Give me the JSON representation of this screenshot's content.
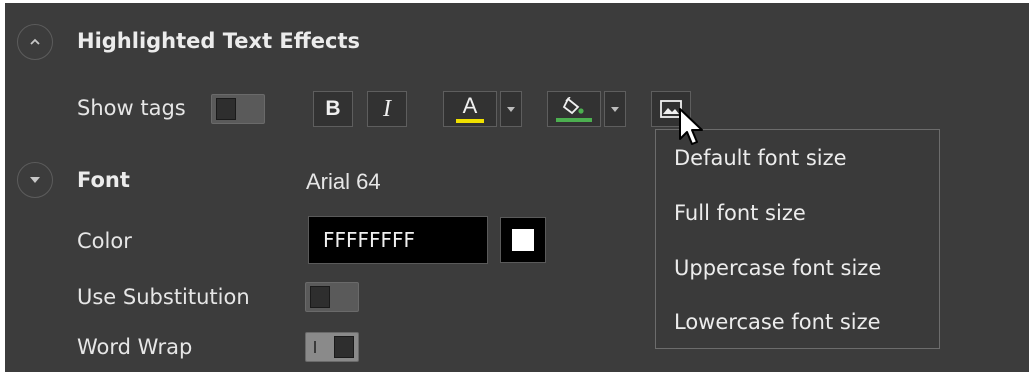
{
  "highlight_section": {
    "title": "Highlighted Text Effects",
    "expander_icon": "chevron-up-icon",
    "show_tags_label": "Show tags",
    "toolbar": {
      "bold_label": "B",
      "italic_label": "I",
      "font_color_label": "A",
      "font_color_swatch": "#f0e000",
      "fill_color_swatch": "#4caf50"
    }
  },
  "font_section": {
    "title": "Font",
    "expander_icon": "chevron-down-icon",
    "font_value": "Arial 64",
    "color_label": "Color",
    "color_value": "FFFFFFFF",
    "color_swatch": "#ffffff",
    "use_substitution_label": "Use Substitution",
    "word_wrap_label": "Word Wrap"
  },
  "size_menu": {
    "items": [
      "Default font size",
      "Full font size",
      "Uppercase font size",
      "Lowercase font size"
    ]
  }
}
